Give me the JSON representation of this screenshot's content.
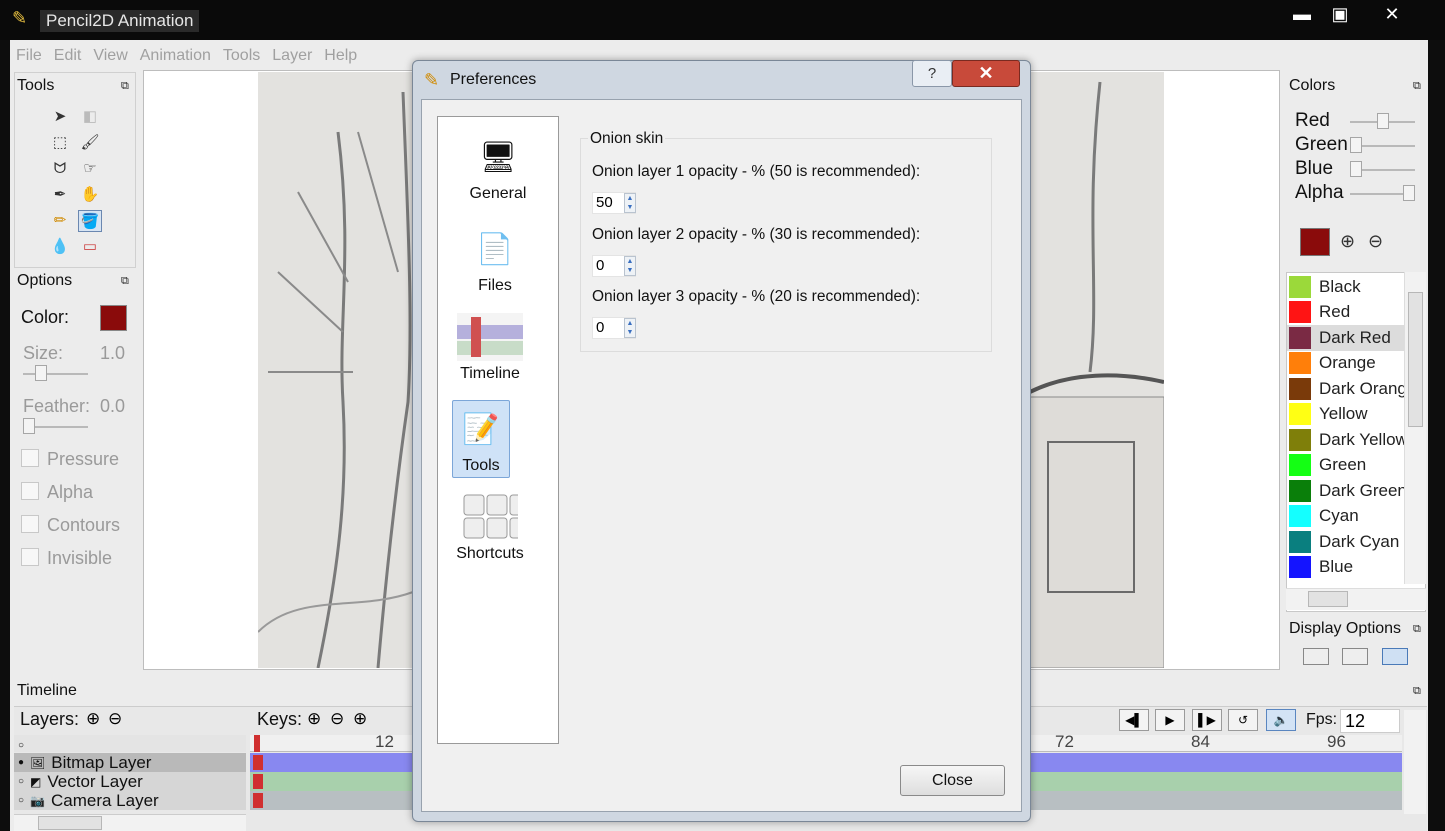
{
  "window": {
    "title": "Pencil2D Animation",
    "minimize": "▬",
    "maximize": "▣",
    "close": "✕"
  },
  "menu": [
    "File",
    "Edit",
    "View",
    "Animation",
    "Tools",
    "Layer",
    "Help"
  ],
  "tools_panel": {
    "title": "Tools",
    "float": "⧉"
  },
  "options_panel": {
    "title": "Options",
    "float": "⧉",
    "color_label": "Color:",
    "size_label": "Size:",
    "size_value": "1.0",
    "feather_label": "Feather:",
    "feather_value": "0.0",
    "checkboxes": [
      "Pressure",
      "Alpha",
      "Contours",
      "Invisible"
    ]
  },
  "colors_panel": {
    "title": "Colors",
    "float": "⧉",
    "sliders": [
      {
        "label": "Red",
        "value": 0.55
      },
      {
        "label": "Green",
        "value": 0.0
      },
      {
        "label": "Blue",
        "value": 0.0
      },
      {
        "label": "Alpha",
        "value": 1.0
      }
    ],
    "current_color": "#8a0b0b",
    "palette": [
      {
        "name": "Black",
        "color": "#9bd93a"
      },
      {
        "name": "Red",
        "color": "#ff1414"
      },
      {
        "name": "Dark Red",
        "color": "#7a2a44"
      },
      {
        "name": "Orange",
        "color": "#ff7f0a"
      },
      {
        "name": "Dark Orang",
        "color": "#7a3a0a"
      },
      {
        "name": "Yellow",
        "color": "#ffff14"
      },
      {
        "name": "Dark Yellow",
        "color": "#7f7f0a"
      },
      {
        "name": "Green",
        "color": "#14ff14"
      },
      {
        "name": "Dark Green",
        "color": "#0a7f0a"
      },
      {
        "name": "Cyan",
        "color": "#14ffff"
      },
      {
        "name": "Dark Cyan",
        "color": "#0a7f7f"
      },
      {
        "name": "Blue",
        "color": "#1414ff"
      }
    ]
  },
  "display_options": {
    "title": "Display Options",
    "float": "⧉"
  },
  "timeline": {
    "title": "Timeline",
    "float": "⧉",
    "layers_label": "Layers:",
    "keys_label": "Keys:",
    "fps_label": "Fps:",
    "fps_value": "12",
    "ruler_ticks": [
      "12",
      "72",
      "84",
      "96"
    ],
    "layers": [
      {
        "name": "Bitmap Layer",
        "color": "#8888f0"
      },
      {
        "name": "Vector Layer",
        "color": "#a8d0ac"
      },
      {
        "name": "Camera Layer",
        "color": "#b8bfc2"
      }
    ]
  },
  "dialog": {
    "title": "Preferences",
    "help": "?",
    "close_x": "✕",
    "pages": [
      {
        "label": "General",
        "icon": "general-icon"
      },
      {
        "label": "Files",
        "icon": "files-icon"
      },
      {
        "label": "Timeline",
        "icon": "timeline-icon"
      },
      {
        "label": "Tools",
        "icon": "tools-icon",
        "selected": true
      },
      {
        "label": "Shortcuts",
        "icon": "shortcuts-icon"
      }
    ],
    "onion": {
      "group_title": "Onion skin",
      "layer1_label": "Onion layer 1 opacity - % (50 is recommended):",
      "layer1_value": "50",
      "layer2_label": "Onion layer 2 opacity - % (30 is recommended):",
      "layer2_value": "0",
      "layer3_label": "Onion layer 3 opacity - % (20 is recommended):",
      "layer3_value": "0"
    },
    "close_button": "Close"
  }
}
